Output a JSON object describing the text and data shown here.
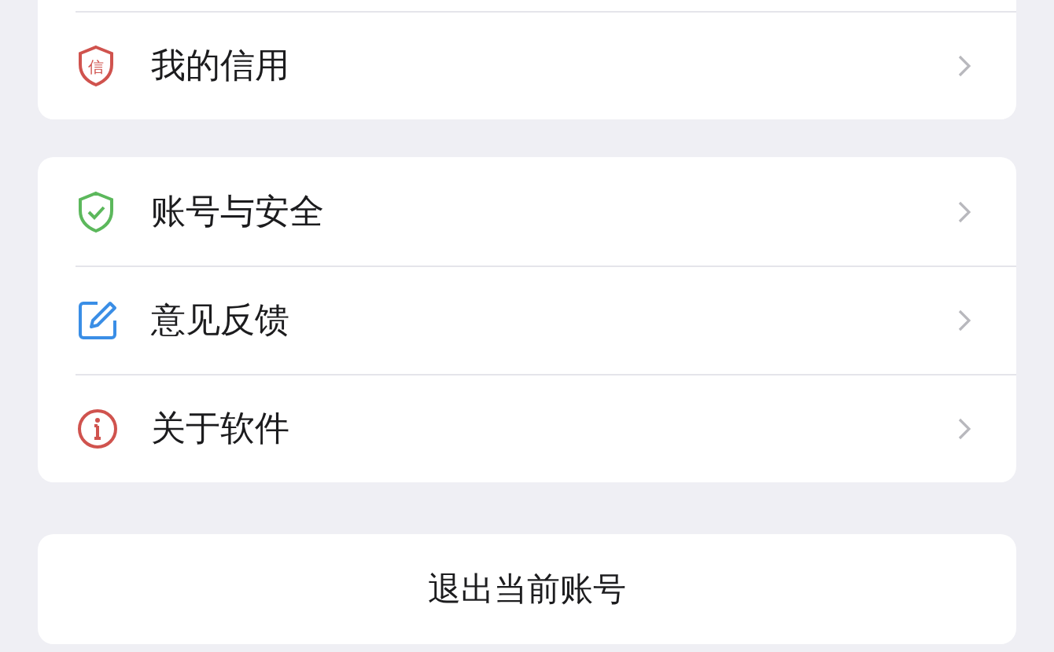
{
  "groups": [
    {
      "items": [
        {
          "label": "我的信用",
          "icon_text": "信"
        }
      ]
    },
    {
      "items": [
        {
          "label": "账号与安全"
        },
        {
          "label": "意见反馈"
        },
        {
          "label": "关于软件"
        }
      ]
    }
  ],
  "logout_button": "退出当前账号"
}
